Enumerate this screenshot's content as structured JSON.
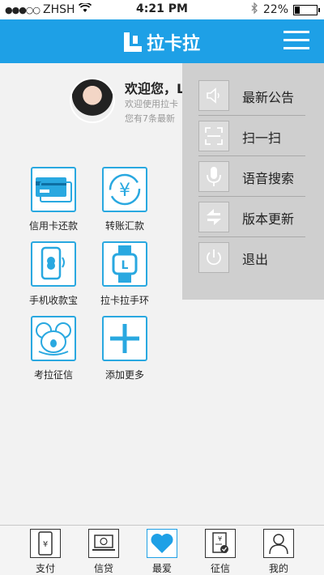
{
  "status_bar": {
    "carrier": "ZHSH",
    "time": "4:21 PM",
    "battery": "22%",
    "battery_level": 0.22
  },
  "nav": {
    "title": "拉卡拉"
  },
  "profile": {
    "welcome": "欢迎您，L",
    "line1": "欢迎使用拉卡",
    "line2": "您有7条最新"
  },
  "grid": [
    {
      "label": "信用卡还款",
      "icon": "credit-card-icon"
    },
    {
      "label": "转账汇款",
      "icon": "yuan-transfer-icon"
    },
    {
      "label": "手机收款宝",
      "icon": "phone-pay-icon"
    },
    {
      "label": "拉卡拉手环",
      "icon": "wristband-icon"
    },
    {
      "label": "考拉征信",
      "icon": "koala-icon"
    },
    {
      "label": "添加更多",
      "icon": "plus-icon"
    }
  ],
  "dropdown": [
    {
      "label": "最新公告",
      "icon": "speaker-icon"
    },
    {
      "label": "扫一扫",
      "icon": "scan-icon"
    },
    {
      "label": "语音搜索",
      "icon": "microphone-icon"
    },
    {
      "label": "版本更新",
      "icon": "refresh-icon"
    },
    {
      "label": "退出",
      "icon": "power-icon"
    }
  ],
  "tabbar": [
    {
      "label": "支付",
      "icon": "phone-yuan-icon"
    },
    {
      "label": "信贷",
      "icon": "laptop-icon"
    },
    {
      "label": "最爱",
      "icon": "heart-icon",
      "active": true
    },
    {
      "label": "征信",
      "icon": "document-check-icon"
    },
    {
      "label": "我的",
      "icon": "user-icon"
    }
  ],
  "colors": {
    "primary": "#1ea0e6",
    "icon_border": "#29a8e0",
    "dropdown_bg": "#cfcfcf"
  }
}
